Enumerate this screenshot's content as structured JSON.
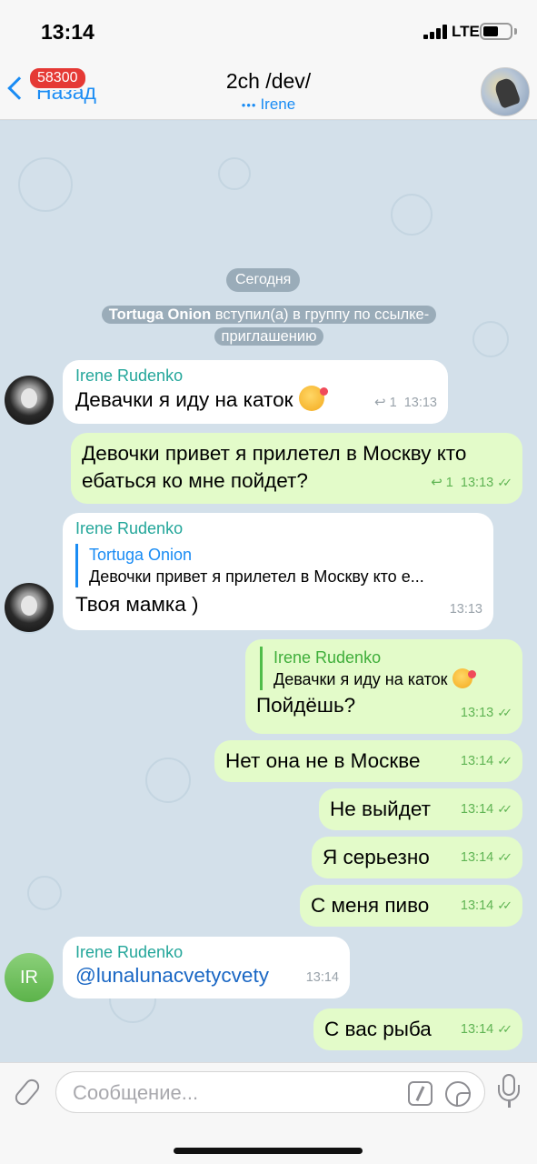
{
  "status_bar": {
    "time": "13:14",
    "network": "LTE",
    "icons": [
      "signal-icon",
      "battery-icon"
    ]
  },
  "header": {
    "back_label": "Назад",
    "unread_badge": "58300",
    "title": "2ch /dev/",
    "subtitle": "Irene",
    "subtitle_state": "typing"
  },
  "date_pill": "Сегодня",
  "service_message": {
    "name": "Tortuga Onion",
    "line1_rest": " вступил(а) в группу по ссылке-",
    "line2": "приглашению"
  },
  "messages": [
    {
      "direction": "in",
      "sender": "Irene Rudenko",
      "text": "Девачки я иду на каток",
      "emoji": "smiling-face-with-hearts",
      "forwards": "1",
      "time": "13:13"
    },
    {
      "direction": "out",
      "text_line1": "Девочки привет я прилетел в Москву кто",
      "text_line2": "ебаться ко мне пойдет?",
      "forwards": "1",
      "time": "13:13",
      "status": "read"
    },
    {
      "direction": "in",
      "sender": "Irene Rudenko",
      "reply_name": "Tortuga Onion",
      "reply_text": "Девочки привет я прилетел в Москву кто е...",
      "text": "Твоя мамка )",
      "time": "13:13"
    },
    {
      "direction": "out",
      "reply_name": "Irene Rudenko",
      "reply_text": "Девачки я иду на каток",
      "reply_emoji": "smiling-face-with-hearts",
      "text": "Пойдёшь?",
      "time": "13:13",
      "status": "read"
    },
    {
      "direction": "out",
      "text": "Нет она не в Москве",
      "time": "13:14",
      "status": "read"
    },
    {
      "direction": "out",
      "text": "Не выйдет",
      "time": "13:14",
      "status": "read"
    },
    {
      "direction": "out",
      "text": "Я серьезно",
      "time": "13:14",
      "status": "read"
    },
    {
      "direction": "out",
      "text": "С меня пиво",
      "time": "13:14",
      "status": "read"
    },
    {
      "direction": "in",
      "sender": "Irene Rudenko",
      "avatar_initials": "IR",
      "text": "@lunalunacvetycvety",
      "time": "13:14"
    },
    {
      "direction": "out",
      "text": "С вас рыба",
      "time": "13:14",
      "status": "read"
    }
  ],
  "input": {
    "placeholder": "Сообщение..."
  },
  "colors": {
    "accent": "#1a8cf4",
    "outgoing_bubble": "#e3fbc9",
    "incoming_bubble": "#ffffff",
    "sender_name": "#23a69a",
    "read_check": "#5fb453"
  }
}
